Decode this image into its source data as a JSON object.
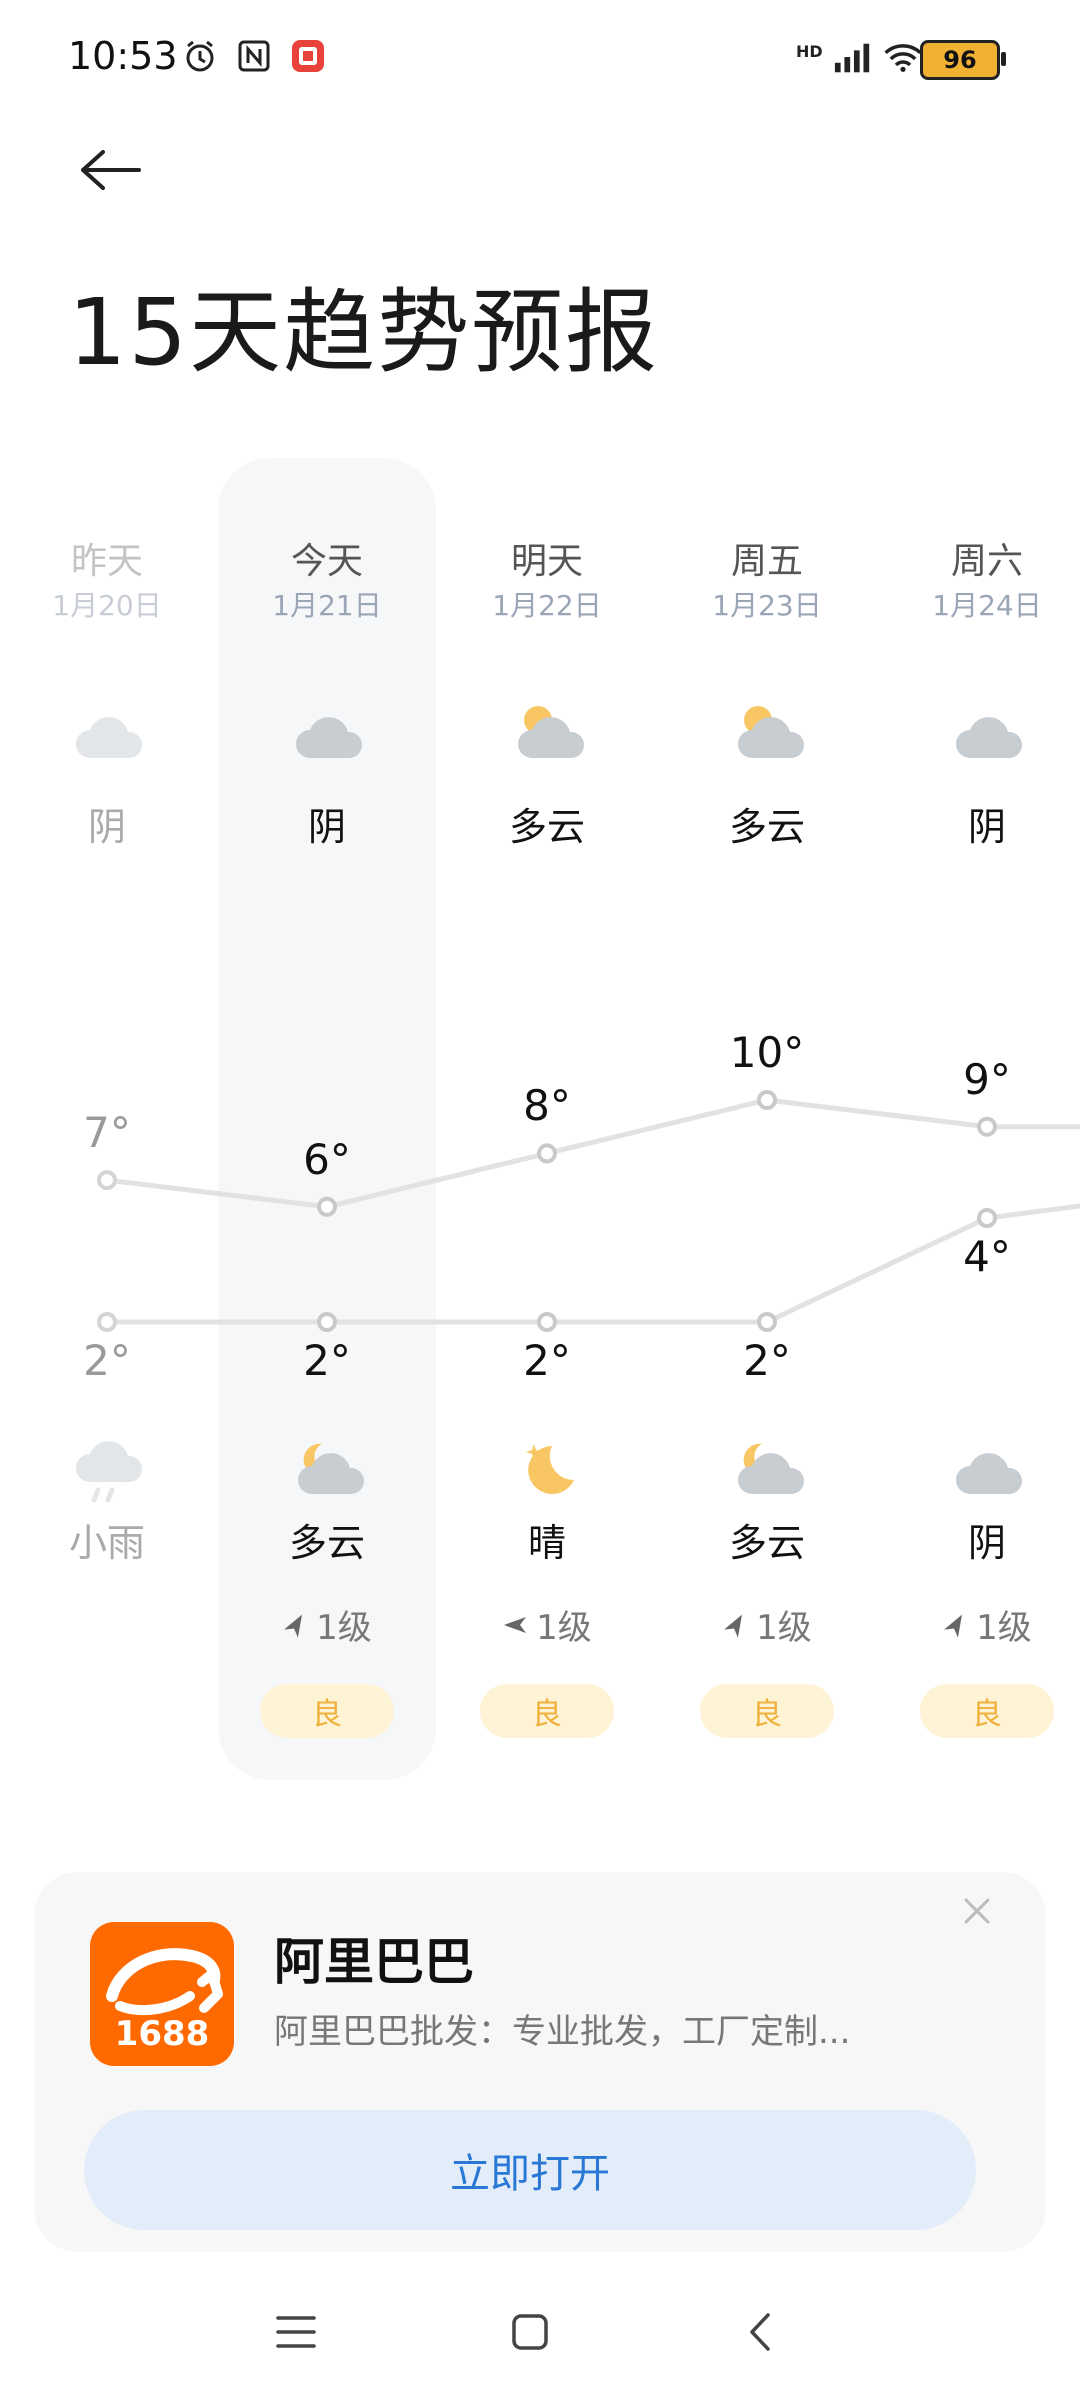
{
  "status_bar": {
    "time": "10:53",
    "battery_level": "96",
    "network_label": "HD"
  },
  "header": {
    "title": "15天趋势预报"
  },
  "forecast": {
    "days": [
      {
        "day": "昨天",
        "date": "1月20日",
        "day_condition": "阴",
        "night_condition": "小雨",
        "high": "7°",
        "low": "2°",
        "wind": "",
        "aqi": "",
        "past": true
      },
      {
        "day": "今天",
        "date": "1月21日",
        "day_condition": "阴",
        "night_condition": "多云",
        "high": "6°",
        "low": "2°",
        "wind": "1级",
        "aqi": "良",
        "past": false
      },
      {
        "day": "明天",
        "date": "1月22日",
        "day_condition": "多云",
        "night_condition": "晴",
        "high": "8°",
        "low": "2°",
        "wind": "1级",
        "aqi": "良",
        "past": false
      },
      {
        "day": "周五",
        "date": "1月23日",
        "day_condition": "多云",
        "night_condition": "多云",
        "high": "10°",
        "low": "2°",
        "wind": "1级",
        "aqi": "良",
        "past": false
      },
      {
        "day": "周六",
        "date": "1月24日",
        "day_condition": "阴",
        "night_condition": "阴",
        "high": "9°",
        "low": "4°",
        "wind": "1级",
        "aqi": "良",
        "past": false
      }
    ]
  },
  "chart_data": {
    "type": "line",
    "categories": [
      "昨天",
      "今天",
      "明天",
      "周五",
      "周六"
    ],
    "series": [
      {
        "values": [
          7,
          6,
          8,
          10,
          9
        ]
      },
      {
        "values": [
          2,
          2,
          2,
          2,
          4
        ]
      }
    ]
  },
  "ad": {
    "app_name": "阿里巴巴",
    "description": "阿里巴巴批发：专业批发，工厂定制...",
    "logo_text": "1688",
    "button_label": "立即打开"
  },
  "colors": {
    "accent_blue": "#2a78d6",
    "aqi_bg": "#fff3d6",
    "aqi_text": "#f0b03a",
    "logo_orange": "#ff6a00"
  }
}
